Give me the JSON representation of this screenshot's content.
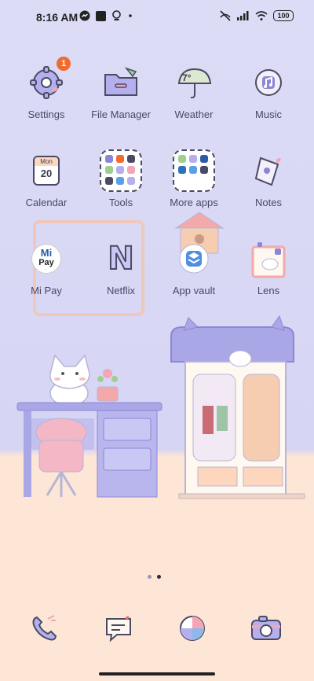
{
  "status": {
    "time": "8:16 AM",
    "battery": "100",
    "icons_left": [
      "facebook-messenger-icon",
      "photo-icon",
      "lens-icon",
      "more-dot-icon"
    ],
    "icons_right": [
      "mute-icon",
      "signal-icon",
      "wifi-icon",
      "battery-icon"
    ]
  },
  "apps": [
    {
      "id": "settings",
      "label": "Settings",
      "badge": "1"
    },
    {
      "id": "file-manager",
      "label": "File Manager"
    },
    {
      "id": "weather",
      "label": "Weather",
      "temp": "7°"
    },
    {
      "id": "music",
      "label": "Music"
    },
    {
      "id": "calendar",
      "label": "Calendar",
      "month": "Mon",
      "day": "20"
    },
    {
      "id": "tools",
      "label": "Tools"
    },
    {
      "id": "more-apps",
      "label": "More apps"
    },
    {
      "id": "notes",
      "label": "Notes"
    },
    {
      "id": "mi-pay",
      "label": "Mi Pay",
      "logo_text": "Mi",
      "logo_sub": "Pay"
    },
    {
      "id": "netflix",
      "label": "Netflix",
      "logo_text": "N"
    },
    {
      "id": "app-vault",
      "label": "App vault"
    },
    {
      "id": "lens",
      "label": "Lens"
    }
  ],
  "pages": {
    "count": 2,
    "active": 2
  },
  "dock": [
    {
      "id": "phone",
      "icon": "phone-icon"
    },
    {
      "id": "messages",
      "icon": "message-icon"
    },
    {
      "id": "browser",
      "icon": "browser-icon"
    },
    {
      "id": "camera",
      "icon": "camera-icon"
    }
  ],
  "colors": {
    "wall": "#d6d5f4",
    "floor": "#fde6d6",
    "badge": "#f26a2e",
    "accent_purple": "#8c86d6"
  }
}
